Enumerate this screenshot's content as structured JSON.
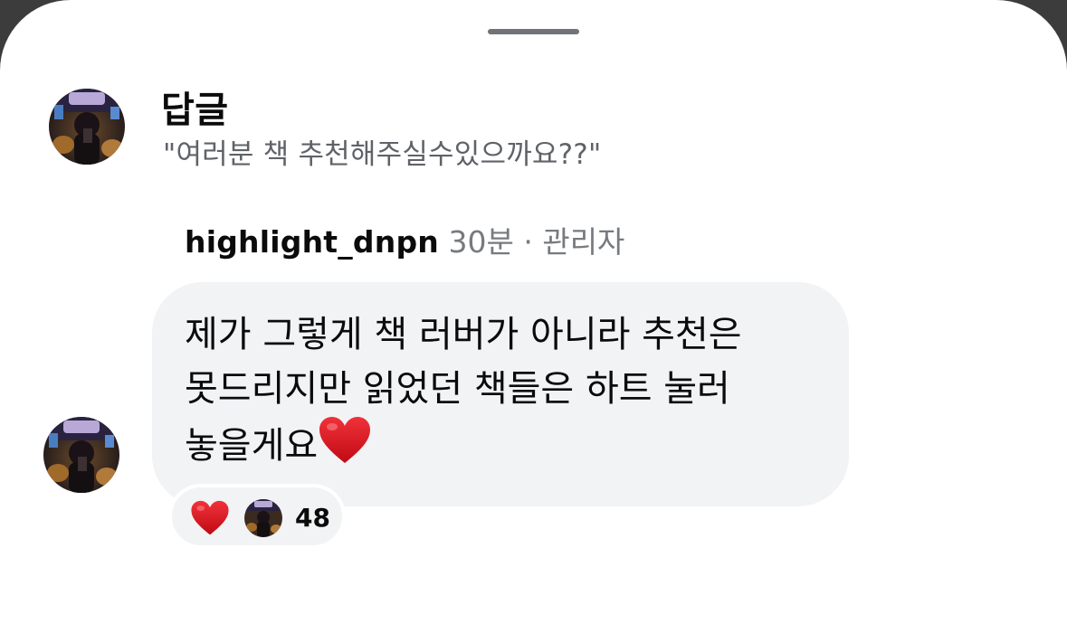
{
  "sheet": {
    "grabber": "drag-handle"
  },
  "header": {
    "title": "답글",
    "original_comment": "\"여러분 책 추천해주실수있으까요??\""
  },
  "reply": {
    "username": "highlight_dnpn",
    "time": "30분",
    "separator": "·",
    "role": "관리자",
    "lines": [
      "제가 그렇게 책 러버가 아니라 추천은",
      "못드리지만 읽었던 책들은 하트 눌러",
      "놓을게요"
    ],
    "trailing_emoji": "heart-icon"
  },
  "reactions": {
    "emoji": "heart-icon",
    "count": "48"
  },
  "colors": {
    "bubble": "#f2f3f5",
    "heart": "#e0121d",
    "secondary_text": "#5f6368"
  }
}
